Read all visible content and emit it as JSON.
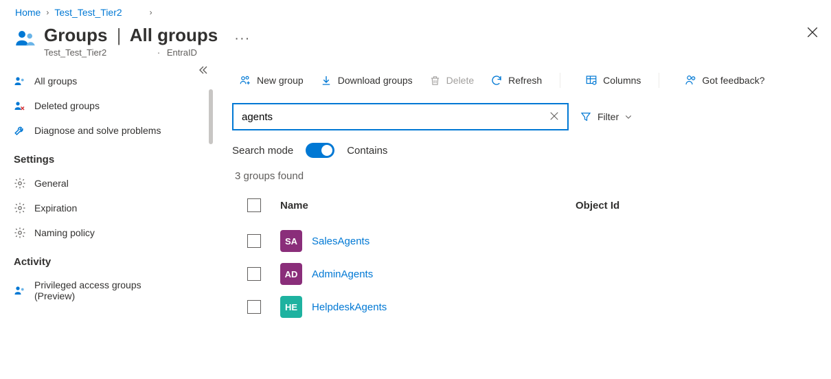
{
  "breadcrumb": {
    "home": "Home",
    "l2": "Test_Test_Tier2"
  },
  "title": {
    "main": "Groups",
    "sub": "All groups",
    "tenant": "Test_Test_Tier2",
    "product": "EntraID"
  },
  "sidebar": {
    "items": [
      "All groups",
      "Deleted groups",
      "Diagnose and solve problems"
    ],
    "settings_header": "Settings",
    "settings_items": [
      "General",
      "Expiration",
      "Naming policy"
    ],
    "activity_header": "Activity",
    "activity_items": [
      "Privileged access groups (Preview)"
    ]
  },
  "toolbar": {
    "new_group": "New group",
    "download": "Download groups",
    "delete": "Delete",
    "refresh": "Refresh",
    "columns": "Columns",
    "feedback": "Got feedback?"
  },
  "search": {
    "value": "agents",
    "filter_label": "Filter",
    "mode_label": "Search mode",
    "mode_value": "Contains"
  },
  "results": {
    "count_text": "3 groups found",
    "headers": {
      "name": "Name",
      "objectId": "Object Id"
    },
    "rows": [
      {
        "initials": "SA",
        "name": "SalesAgents",
        "color": "#8a2e7a"
      },
      {
        "initials": "AD",
        "name": "AdminAgents",
        "color": "#8a2e7a"
      },
      {
        "initials": "HE",
        "name": "HelpdeskAgents",
        "color": "#1eb2a0"
      }
    ]
  }
}
